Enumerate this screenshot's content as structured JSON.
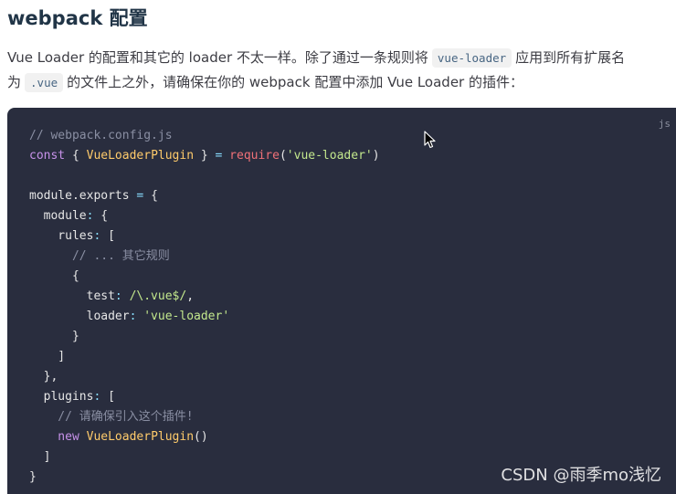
{
  "heading": "webpack 配置",
  "paragraph": {
    "text1": "Vue Loader 的配置和其它的 loader 不太一样。除了通过一条规则将",
    "code1": "vue-loader",
    "text2": "应用到所有扩展名为",
    "code2": ".vue",
    "text3": "的文件上之外，请确保在你的 webpack 配置中添加 Vue Loader 的插件："
  },
  "code_block": {
    "language": "js",
    "lines": [
      [
        {
          "t": "// webpack.config.js",
          "c": "comment"
        }
      ],
      [
        {
          "t": "const",
          "c": "kw"
        },
        {
          "t": " { ",
          "c": "punc"
        },
        {
          "t": "VueLoaderPlugin",
          "c": "cls"
        },
        {
          "t": " } ",
          "c": "punc"
        },
        {
          "t": "=",
          "c": "op"
        },
        {
          "t": " ",
          "c": "punc"
        },
        {
          "t": "require",
          "c": "fn"
        },
        {
          "t": "(",
          "c": "punc"
        },
        {
          "t": "'vue-loader'",
          "c": "str"
        },
        {
          "t": ")",
          "c": "punc"
        }
      ],
      [],
      [
        {
          "t": "module",
          "c": "prop"
        },
        {
          "t": ".",
          "c": "punc"
        },
        {
          "t": "exports",
          "c": "prop"
        },
        {
          "t": " ",
          "c": "punc"
        },
        {
          "t": "=",
          "c": "op"
        },
        {
          "t": " {",
          "c": "punc"
        }
      ],
      [
        {
          "t": "  module",
          "c": "prop"
        },
        {
          "t": ":",
          "c": "op"
        },
        {
          "t": " {",
          "c": "punc"
        }
      ],
      [
        {
          "t": "    rules",
          "c": "prop"
        },
        {
          "t": ":",
          "c": "op"
        },
        {
          "t": " [",
          "c": "punc"
        }
      ],
      [
        {
          "t": "      // ... 其它规则",
          "c": "comment"
        }
      ],
      [
        {
          "t": "      {",
          "c": "punc"
        }
      ],
      [
        {
          "t": "        test",
          "c": "prop"
        },
        {
          "t": ":",
          "c": "op"
        },
        {
          "t": " ",
          "c": "punc"
        },
        {
          "t": "/\\.vue$/",
          "c": "re"
        },
        {
          "t": ",",
          "c": "punc"
        }
      ],
      [
        {
          "t": "        loader",
          "c": "prop"
        },
        {
          "t": ":",
          "c": "op"
        },
        {
          "t": " ",
          "c": "punc"
        },
        {
          "t": "'vue-loader'",
          "c": "str"
        }
      ],
      [
        {
          "t": "      }",
          "c": "punc"
        }
      ],
      [
        {
          "t": "    ]",
          "c": "punc"
        }
      ],
      [
        {
          "t": "  },",
          "c": "punc"
        }
      ],
      [
        {
          "t": "  plugins",
          "c": "prop"
        },
        {
          "t": ":",
          "c": "op"
        },
        {
          "t": " [",
          "c": "punc"
        }
      ],
      [
        {
          "t": "    // 请确保引入这个插件!",
          "c": "comment"
        }
      ],
      [
        {
          "t": "    new",
          "c": "kw"
        },
        {
          "t": " ",
          "c": "punc"
        },
        {
          "t": "VueLoaderPlugin",
          "c": "cls"
        },
        {
          "t": "()",
          "c": "punc"
        }
      ],
      [
        {
          "t": "  ]",
          "c": "punc"
        }
      ],
      [
        {
          "t": "}",
          "c": "punc"
        }
      ]
    ]
  },
  "watermark": "CSDN @雨季mo浅忆",
  "colors": {
    "code_bg": "#292d3e",
    "comment": "#8a8fa3",
    "keyword": "#c792ea",
    "class": "#ffcb6b",
    "function": "#f07178",
    "string": "#c3e88d",
    "operator": "#89ddff"
  },
  "icons": {
    "cursor": "mouse-pointer-icon"
  }
}
